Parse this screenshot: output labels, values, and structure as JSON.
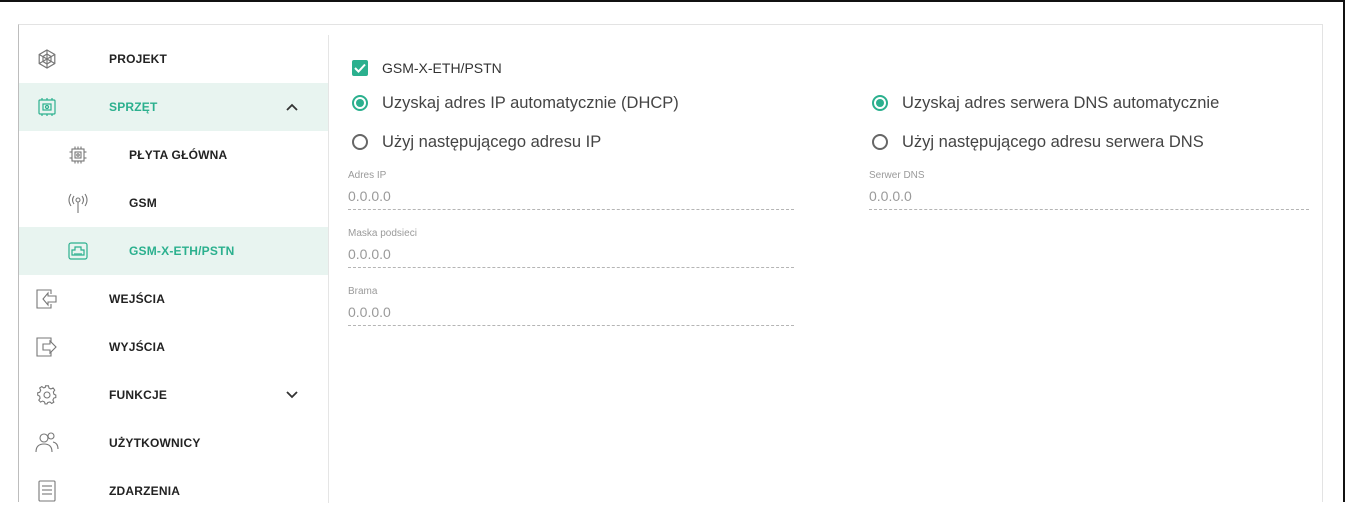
{
  "sidebar": {
    "items": [
      {
        "label": "PROJEKT",
        "icon": "project-icon"
      },
      {
        "label": "SPRZĘT",
        "icon": "hardware-icon",
        "expanded": true
      },
      {
        "label": "PŁYTA GŁÓWNA",
        "icon": "mainboard-icon"
      },
      {
        "label": "GSM",
        "icon": "antenna-icon"
      },
      {
        "label": "GSM-X-ETH/PSTN",
        "icon": "ethernet-port-icon",
        "selected": true
      },
      {
        "label": "WEJŚCIA",
        "icon": "input-icon"
      },
      {
        "label": "WYJŚCIA",
        "icon": "output-icon"
      },
      {
        "label": "FUNKCJE",
        "icon": "gear-icon",
        "expanded": false
      },
      {
        "label": "UŻYTKOWNICY",
        "icon": "users-icon"
      },
      {
        "label": "ZDARZENIA",
        "icon": "events-icon"
      }
    ]
  },
  "module": {
    "checkbox_label": "GSM-X-ETH/PSTN",
    "checked": true
  },
  "ip": {
    "radio_auto": "Uzyskaj adres IP automatycznie (DHCP)",
    "radio_manual": "Użyj następującego adresu IP",
    "selected": "auto",
    "fields": [
      {
        "label": "Adres IP",
        "value": "0.0.0.0"
      },
      {
        "label": "Maska podsieci",
        "value": "0.0.0.0"
      },
      {
        "label": "Brama",
        "value": "0.0.0.0"
      }
    ]
  },
  "dns": {
    "radio_auto": "Uzyskaj adres serwera DNS automatycznie",
    "radio_manual": "Użyj następującego adresu serwera DNS",
    "selected": "auto",
    "fields": [
      {
        "label": "Serwer DNS",
        "value": "0.0.0.0"
      }
    ]
  },
  "colors": {
    "accent": "#2bb08e",
    "active_bg": "#e8f4f0"
  }
}
